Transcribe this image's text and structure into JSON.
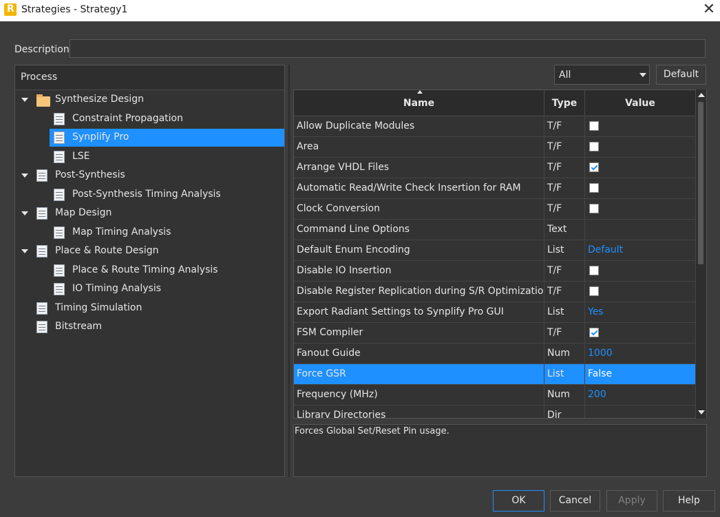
{
  "window": {
    "app_icon_letter": "R",
    "title": "Strategies - Strategy1",
    "close_glyph": "✕"
  },
  "description": {
    "label": "Description:",
    "value": ""
  },
  "process": {
    "header": "Process",
    "tree": [
      {
        "label": "Synthesize Design",
        "icon": "folder-icon",
        "expanded": true,
        "level": 0
      },
      {
        "label": "Constraint Propagation",
        "icon": "strategy-doc-icon",
        "level": 1
      },
      {
        "label": "Synplify Pro",
        "icon": "strategy-doc-icon",
        "level": 1,
        "selected": true
      },
      {
        "label": "LSE",
        "icon": "strategy-doc-icon",
        "level": 1
      },
      {
        "label": "Post-Synthesis",
        "icon": "strategy-doc-icon",
        "expanded": true,
        "level": 0
      },
      {
        "label": "Post-Synthesis Timing Analysis",
        "icon": "strategy-doc-icon",
        "level": 1
      },
      {
        "label": "Map Design",
        "icon": "strategy-doc-icon",
        "expanded": true,
        "level": 0
      },
      {
        "label": "Map Timing Analysis",
        "icon": "strategy-doc-icon",
        "level": 1
      },
      {
        "label": "Place & Route Design",
        "icon": "strategy-doc-icon",
        "expanded": true,
        "level": 0
      },
      {
        "label": "Place & Route Timing Analysis",
        "icon": "strategy-doc-icon",
        "level": 1
      },
      {
        "label": "IO Timing Analysis",
        "icon": "strategy-doc-icon",
        "level": 1
      },
      {
        "label": "Timing Simulation",
        "icon": "strategy-doc-icon",
        "level": 0
      },
      {
        "label": "Bitstream",
        "icon": "strategy-doc-icon",
        "level": 0
      }
    ]
  },
  "filter": {
    "selected": "All",
    "default_button": "Default"
  },
  "grid": {
    "columns": [
      "Name",
      "Type",
      "Value"
    ],
    "rows": [
      {
        "name": "Allow Duplicate Modules",
        "type": "T/F",
        "kind": "check",
        "checked": false
      },
      {
        "name": "Area",
        "type": "T/F",
        "kind": "check",
        "checked": false
      },
      {
        "name": "Arrange VHDL Files",
        "type": "T/F",
        "kind": "check",
        "checked": true
      },
      {
        "name": "Automatic Read/Write Check Insertion for RAM",
        "type": "T/F",
        "kind": "check",
        "checked": false
      },
      {
        "name": "Clock Conversion",
        "type": "T/F",
        "kind": "check",
        "checked": false
      },
      {
        "name": "Command Line Options",
        "type": "Text",
        "kind": "text",
        "value": ""
      },
      {
        "name": "Default Enum Encoding",
        "type": "List",
        "kind": "text",
        "value": "Default"
      },
      {
        "name": "Disable IO Insertion",
        "type": "T/F",
        "kind": "check",
        "checked": false
      },
      {
        "name": "Disable Register Replication during S/R Optimization",
        "type": "T/F",
        "kind": "check",
        "checked": false
      },
      {
        "name": "Export Radiant Settings to Synplify Pro GUI",
        "type": "List",
        "kind": "text",
        "value": "Yes"
      },
      {
        "name": "FSM Compiler",
        "type": "T/F",
        "kind": "check",
        "checked": true
      },
      {
        "name": "Fanout Guide",
        "type": "Num",
        "kind": "text",
        "value": "1000"
      },
      {
        "name": "Force GSR",
        "type": "List",
        "kind": "text",
        "value": "False",
        "selected": true
      },
      {
        "name": "Frequency (MHz)",
        "type": "Num",
        "kind": "text",
        "value": "200"
      },
      {
        "name": "Library Directories",
        "type": "Dir",
        "kind": "text",
        "value": ""
      }
    ]
  },
  "help_text": "Forces Global Set/Reset Pin usage.",
  "buttons": {
    "ok": "OK",
    "cancel": "Cancel",
    "apply": "Apply",
    "help": "Help"
  },
  "colors": {
    "accent": "#1e90ff",
    "background": "#3c3c3c",
    "panel": "#333333"
  }
}
